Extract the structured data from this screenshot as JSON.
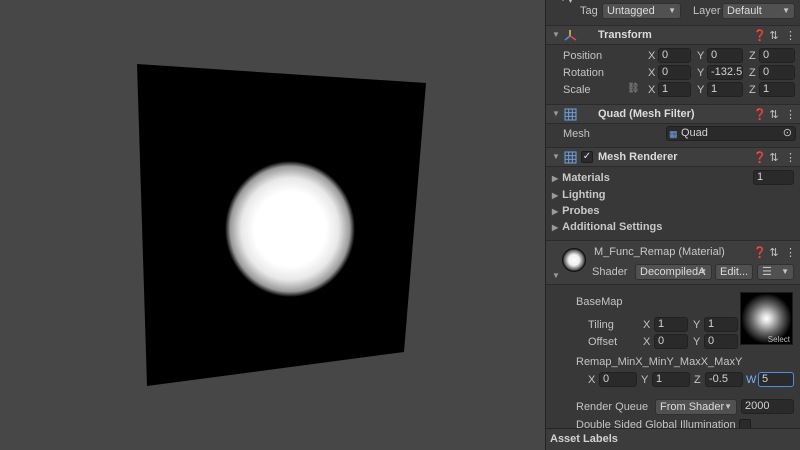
{
  "header": {
    "tag_label": "Tag",
    "tag_value": "Untagged",
    "layer_label": "Layer",
    "layer_value": "Default"
  },
  "transform": {
    "title": "Transform",
    "position": {
      "label": "Position",
      "x": "0",
      "y": "0",
      "z": "0"
    },
    "rotation": {
      "label": "Rotation",
      "x": "0",
      "y": "-132.5",
      "z": "0"
    },
    "scale": {
      "label": "Scale",
      "x": "1",
      "y": "1",
      "z": "1"
    }
  },
  "mesh_filter": {
    "title": "Quad (Mesh Filter)",
    "mesh_label": "Mesh",
    "mesh_value": "Quad"
  },
  "mesh_renderer": {
    "title": "Mesh Renderer",
    "materials_label": "Materials",
    "materials_count": "1",
    "lighting_label": "Lighting",
    "probes_label": "Probes",
    "additional_label": "Additional Settings"
  },
  "material": {
    "title": "M_Func_Remap (Material)",
    "shader_label": "Shader",
    "shader_value": "DecompiledA",
    "edit_label": "Edit...",
    "basemap_label": "BaseMap",
    "tiling_label": "Tiling",
    "tiling_x": "1",
    "tiling_y": "1",
    "offset_label": "Offset",
    "offset_x": "0",
    "offset_y": "0",
    "select_label": "Select",
    "remap_label": "Remap_MinX_MinY_MaxX_MaxY",
    "remap_x": "0",
    "remap_y": "1",
    "remap_z": "-0.5",
    "remap_w": "5",
    "render_queue_label": "Render Queue",
    "render_queue_mode": "From Shader",
    "render_queue_value": "2000",
    "double_sided_label": "Double Sided Global Illumination"
  },
  "footer": {
    "asset_labels": "Asset Labels"
  },
  "colors": {
    "scene_bg": "#474747",
    "inspector_bg": "#383838",
    "accent": "#4c8ee6"
  }
}
